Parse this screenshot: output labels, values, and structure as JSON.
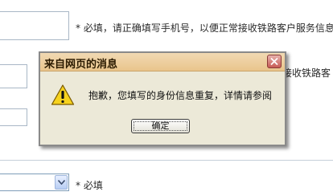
{
  "form": {
    "phone_hint": "* 必填，请正确填写手机号，以便正常接收铁路客户服务信息",
    "rail_hint": "接收铁路客",
    "required_hint": "* 必填"
  },
  "dialog": {
    "title": "来自网页的消息",
    "message": "抱歉，您填写的身份信息重复，详情请参阅",
    "ok_label": "确定",
    "icon": "warning-icon"
  },
  "colors": {
    "dialog_bg": "#ece9d8",
    "titlebar": "#e9c58c",
    "close_button": "#c75b55",
    "warning_yellow": "#f6d21e"
  }
}
